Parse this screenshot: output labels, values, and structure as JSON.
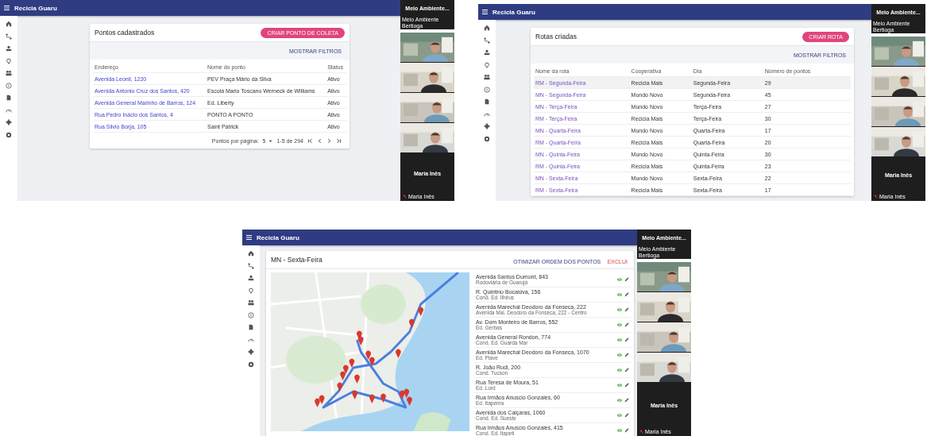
{
  "screens": [
    {
      "kind": "points",
      "app_title": "Recicla Guaru",
      "card": {
        "title": "Pontos cadastrados",
        "create_button": "CRIAR PONTO DE COLETA",
        "filter_button": "MOSTRAR FILTROS",
        "columns": [
          "Endereço",
          "Nome do ponto",
          "Status"
        ],
        "rows": [
          {
            "address": "Avenida Leonil, 1220",
            "name": "PEV Praça Mário da Silva",
            "status": "Ativo"
          },
          {
            "address": "Avenida Antonio Cruz dos Santos, 420",
            "name": "Escola Mario Toscano Werneck de Williams",
            "status": "Ativo"
          },
          {
            "address": "Avenida General Marinho de Barros, 124",
            "name": "Ed. Liberty",
            "status": "Ativo"
          },
          {
            "address": "Rua Pedro Inácio dos Santos, 4",
            "name": "PONTO A PONTO",
            "status": "Ativo"
          },
          {
            "address": "Rua Silvio Borja, 105",
            "name": "Saint Patrick",
            "status": "Ativo"
          }
        ],
        "pagination": {
          "label": "Pontos por página:",
          "page_size": "5",
          "range": "1-5 de 294"
        }
      },
      "call": {
        "title": "Meio Ambiente...",
        "subtitle": "Meio Ambiente Bertioga",
        "speaker": "Maria Inês",
        "speaker_label": "Maria Inês"
      }
    },
    {
      "kind": "routes",
      "app_title": "Recicla Guaru",
      "card": {
        "title": "Rotas criadas",
        "create_button": "CRIAR ROTA",
        "filter_button": "MOSTRAR FILTROS",
        "columns": [
          "Nome da rota",
          "Cooperativa",
          "Dia",
          "Número de pontos"
        ],
        "rows": [
          {
            "route": "RM - Segunda-Feira",
            "coop": "Recicla Mais",
            "day": "Segunda-Feira",
            "points": "29",
            "highlighted": true
          },
          {
            "route": "MN - Segunda-Feira",
            "coop": "Mundo Novo",
            "day": "Segunda-Feira",
            "points": "45",
            "highlighted": false
          },
          {
            "route": "MN - Terça-Feira",
            "coop": "Mundo Novo",
            "day": "Terça-Feira",
            "points": "27",
            "highlighted": false
          },
          {
            "route": "RM - Terça-Feira",
            "coop": "Recicla Mais",
            "day": "Terça-Feira",
            "points": "30",
            "highlighted": false
          },
          {
            "route": "MN - Quarta-Feira",
            "coop": "Mundo Novo",
            "day": "Quarta-Feira",
            "points": "17",
            "highlighted": false
          },
          {
            "route": "RM - Quarta-Feira",
            "coop": "Recicla Mais",
            "day": "Quarta-Feira",
            "points": "20",
            "highlighted": false
          },
          {
            "route": "MN - Quinta-Feira",
            "coop": "Mundo Novo",
            "day": "Quinta-Feira",
            "points": "30",
            "highlighted": false
          },
          {
            "route": "RM - Quinta-Feira",
            "coop": "Recicla Mais",
            "day": "Quinta-Feira",
            "points": "23",
            "highlighted": false
          },
          {
            "route": "MN - Sexta-Feira",
            "coop": "Mundo Novo",
            "day": "Sexta-Feira",
            "points": "22",
            "highlighted": false
          },
          {
            "route": "RM - Sexta-Feira",
            "coop": "Recicla Mais",
            "day": "Sexta-Feira",
            "points": "17",
            "highlighted": false
          }
        ]
      },
      "call": {
        "title": "Meio Ambiente...",
        "subtitle": "Meio Ambiente Bertioga",
        "speaker": "Maria Inês",
        "speaker_label": "Maria Inês"
      }
    },
    {
      "kind": "route_detail",
      "app_title": "Recicla Guaru",
      "card": {
        "title": "MN - Sexta-Feira",
        "optimize_button": "OTIMIZAR ORDEM DOS PONTOS",
        "delete_button": "EXCLUI",
        "stops": [
          {
            "address": "Avenida Santos Dumont, 843",
            "name": "Rodoviária de Guarujá"
          },
          {
            "address": "R. Quintino Bocaiúva, 156",
            "name": "Cond. Ed. Ilhéus"
          },
          {
            "address": "Avenida Marechal Deodoro da Fonseca, 222",
            "name": "Avenida Mal. Deodoro da Fonseca, 222 - Centro"
          },
          {
            "address": "Av. Dom Monteiro de Barros, 552",
            "name": "Ed. Gerbas"
          },
          {
            "address": "Avenida General Rondon, 774",
            "name": "Cond. Ed. Guarda Mar"
          },
          {
            "address": "Avenida Marechal Deodoro da Fonseca, 1070",
            "name": "Ed. Piave"
          },
          {
            "address": "R. João Rudi, 200",
            "name": "Cond. Tucson"
          },
          {
            "address": "Rua Teresa de Moura, 51",
            "name": "Ed. Lord"
          },
          {
            "address": "Rua Irmãos Anuscio Gonzales, 60",
            "name": "Ed. Itapema"
          },
          {
            "address": "Avenida dos Caiçaras, 1060",
            "name": "Cond. Ed. Sueste"
          },
          {
            "address": "Rua Irmãos Anuscio Gonzales, 415",
            "name": "Cond. Ed. Itapeti"
          }
        ]
      },
      "call": {
        "title": "Meio Ambiente...",
        "subtitle": "Meio Ambiente Bertioga",
        "speaker": "Maria Inês",
        "speaker_label": "Maria Inês"
      }
    }
  ]
}
